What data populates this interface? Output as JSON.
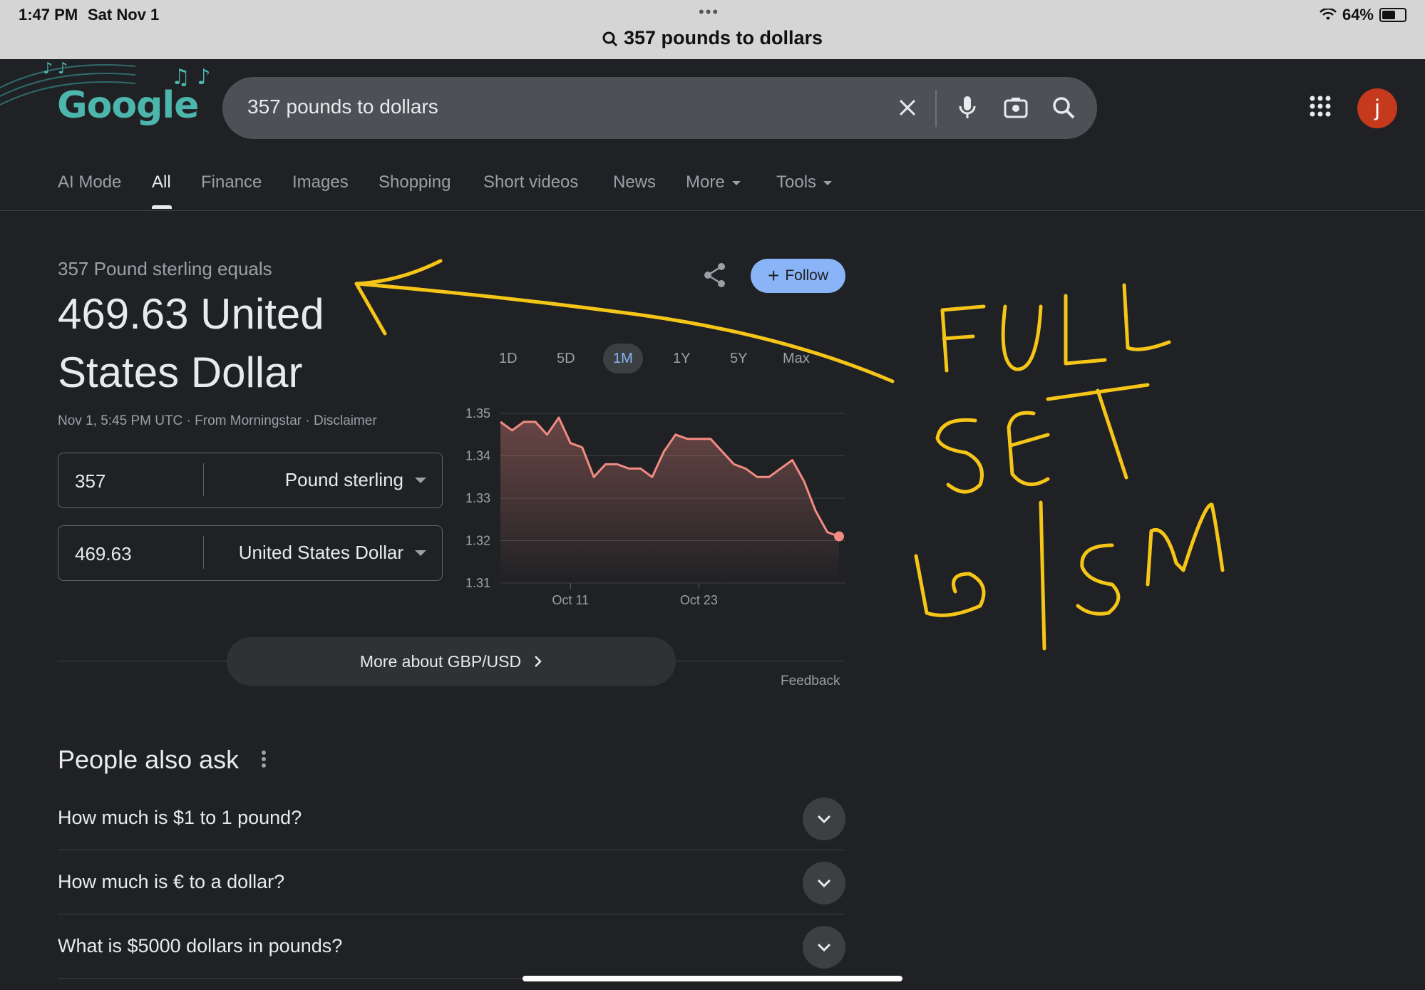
{
  "status": {
    "time": "1:47 PM",
    "date": "Sat Nov 1",
    "battery": "64%",
    "battery_level": 0.64,
    "dots": "•••"
  },
  "url_bar": {
    "query": "357 pounds to dollars"
  },
  "logo": {
    "text": "Google"
  },
  "search": {
    "value": "357 pounds to dollars"
  },
  "avatar": {
    "letter": "j",
    "color": "#c5391d"
  },
  "tabs": [
    {
      "label": "AI Mode"
    },
    {
      "label": "All"
    },
    {
      "label": "Finance"
    },
    {
      "label": "Images"
    },
    {
      "label": "Shopping"
    },
    {
      "label": "Short videos"
    },
    {
      "label": "News"
    },
    {
      "label": "More"
    },
    {
      "label": "Tools"
    }
  ],
  "converter": {
    "equals_text": "357 Pound sterling equals",
    "result_line1": "469.63 United",
    "result_line2": "States Dollar",
    "source": "Nov 1, 5:45 PM UTC · From Morningstar · Disclaimer",
    "follow_label": "Follow",
    "from": {
      "value": "357",
      "unit": "Pound sterling"
    },
    "to": {
      "value": "469.63",
      "unit": "United States Dollar"
    }
  },
  "ranges": [
    "1D",
    "5D",
    "1M",
    "1Y",
    "5Y",
    "Max"
  ],
  "active_range": "1M",
  "chart_data": {
    "type": "area",
    "ylim": [
      1.31,
      1.35
    ],
    "yticks": [
      "1.35",
      "1.34",
      "1.33",
      "1.32",
      "1.31"
    ],
    "xticks": [
      "Oct 11",
      "Oct 23"
    ],
    "line_color": "#f28b82",
    "values": [
      1.348,
      1.346,
      1.348,
      1.348,
      1.345,
      1.349,
      1.343,
      1.342,
      1.335,
      1.338,
      1.338,
      1.337,
      1.337,
      1.335,
      1.341,
      1.345,
      1.344,
      1.344,
      1.344,
      1.341,
      1.338,
      1.337,
      1.335,
      1.335,
      1.337,
      1.339,
      1.334,
      1.327,
      1.322,
      1.321
    ]
  },
  "more_about": {
    "label": "More about GBP/USD"
  },
  "feedback": "Feedback",
  "people_also_ask": {
    "title": "People also ask",
    "questions": [
      "How much is $1 to 1 pound?",
      "How much is € to a dollar?",
      "What is $5000 dollars in pounds?"
    ]
  },
  "annotation": {
    "lines": [
      "FULL",
      "SET",
      "LG|SM"
    ],
    "color": "#f5c518"
  }
}
